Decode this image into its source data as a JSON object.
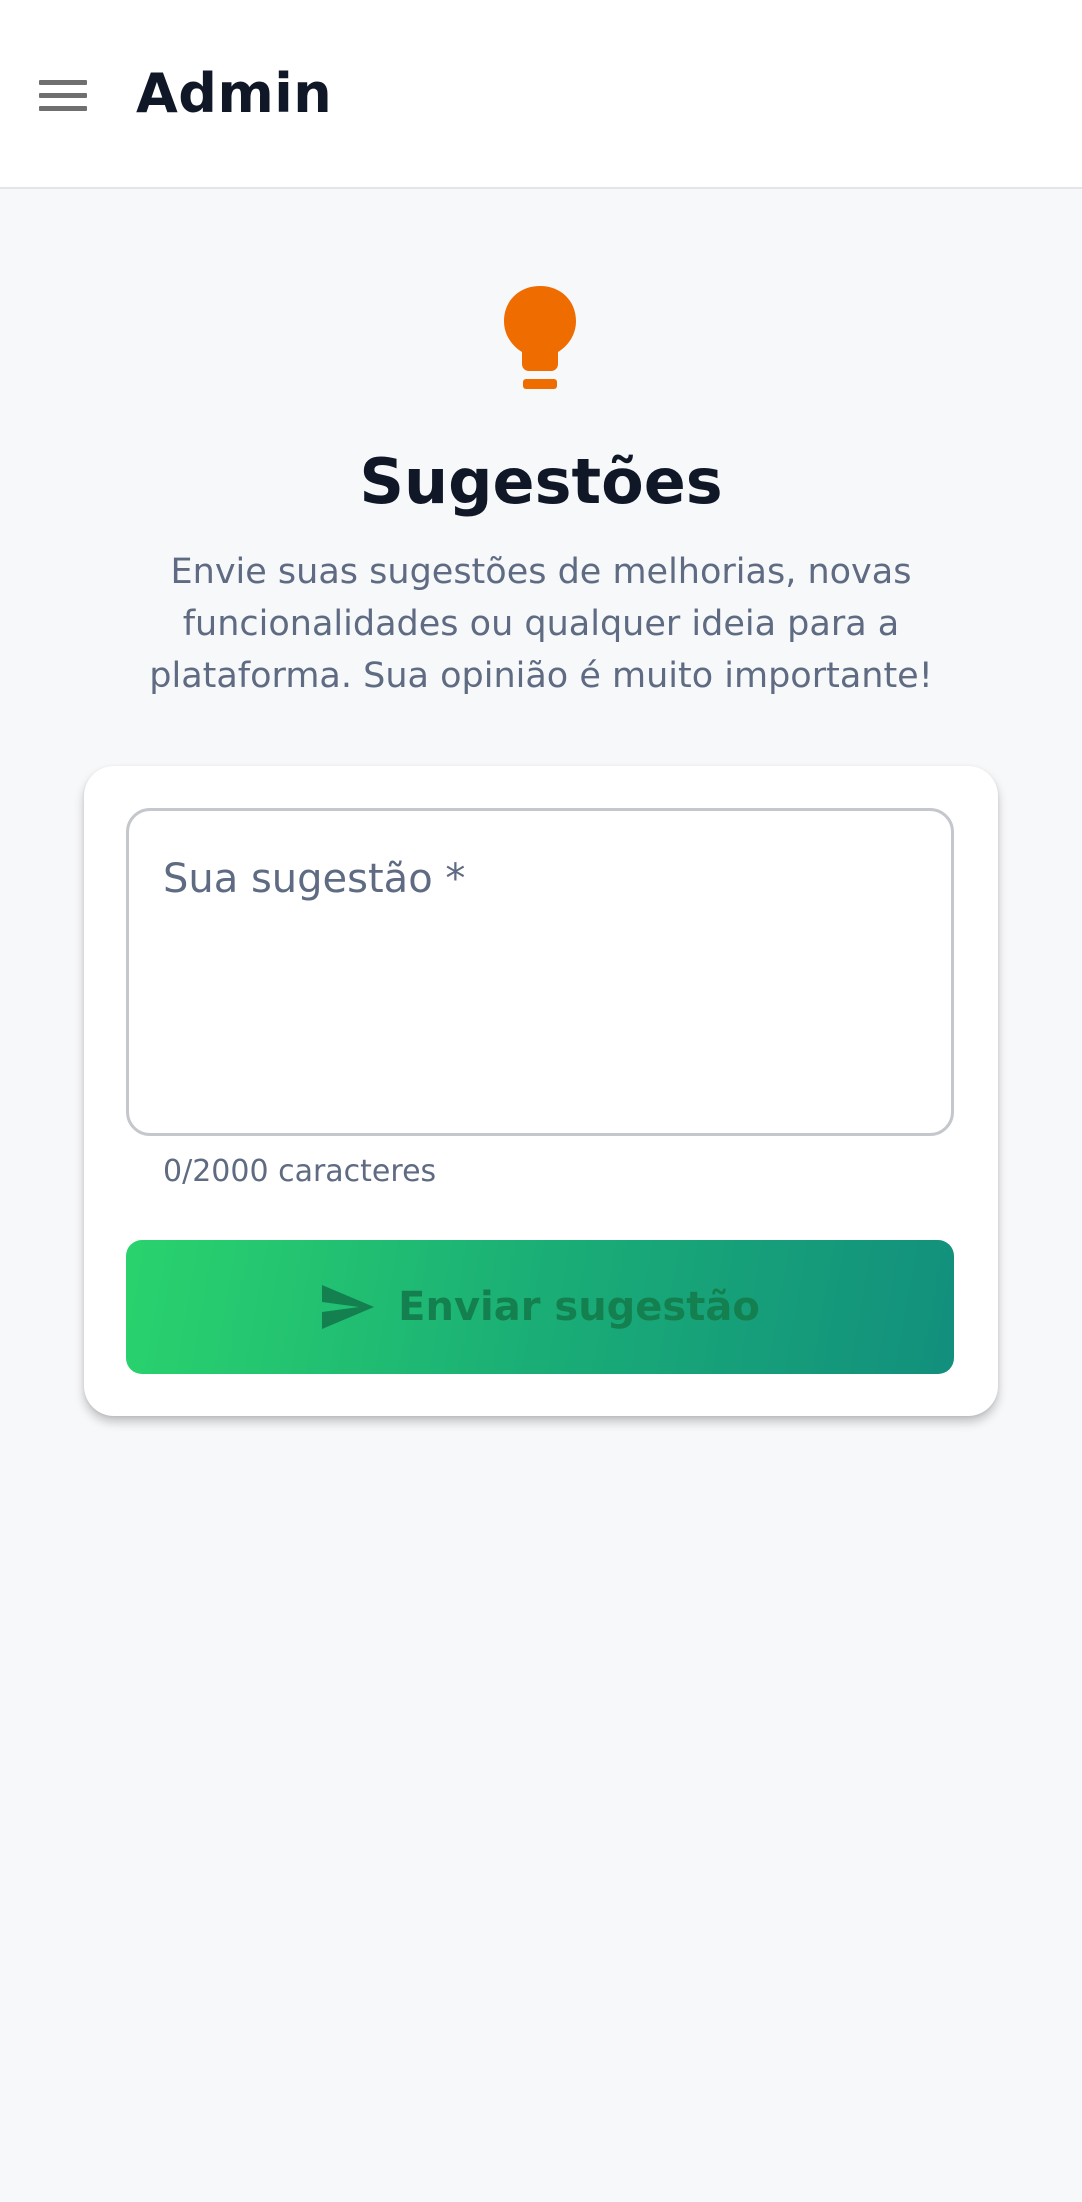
{
  "appbar": {
    "title": "Admin",
    "menu_icon": "menu-icon"
  },
  "hero": {
    "icon": "lightbulb-icon",
    "icon_color": "#ef6c00",
    "title": "Sugestões",
    "subtitle": "Envie suas sugestões de melhorias, novas funcionalidades ou qualquer ideia para a plataforma. Sua opinião é muito importante!"
  },
  "form": {
    "suggestion_label": "Sua sugestão *",
    "suggestion_value": "",
    "char_counter": "0/2000 caracteres",
    "submit_label": "Enviar sugestão",
    "submit_icon": "send-icon",
    "submit_gradient_start": "#2ad36d",
    "submit_gradient_end": "#128f7d"
  }
}
